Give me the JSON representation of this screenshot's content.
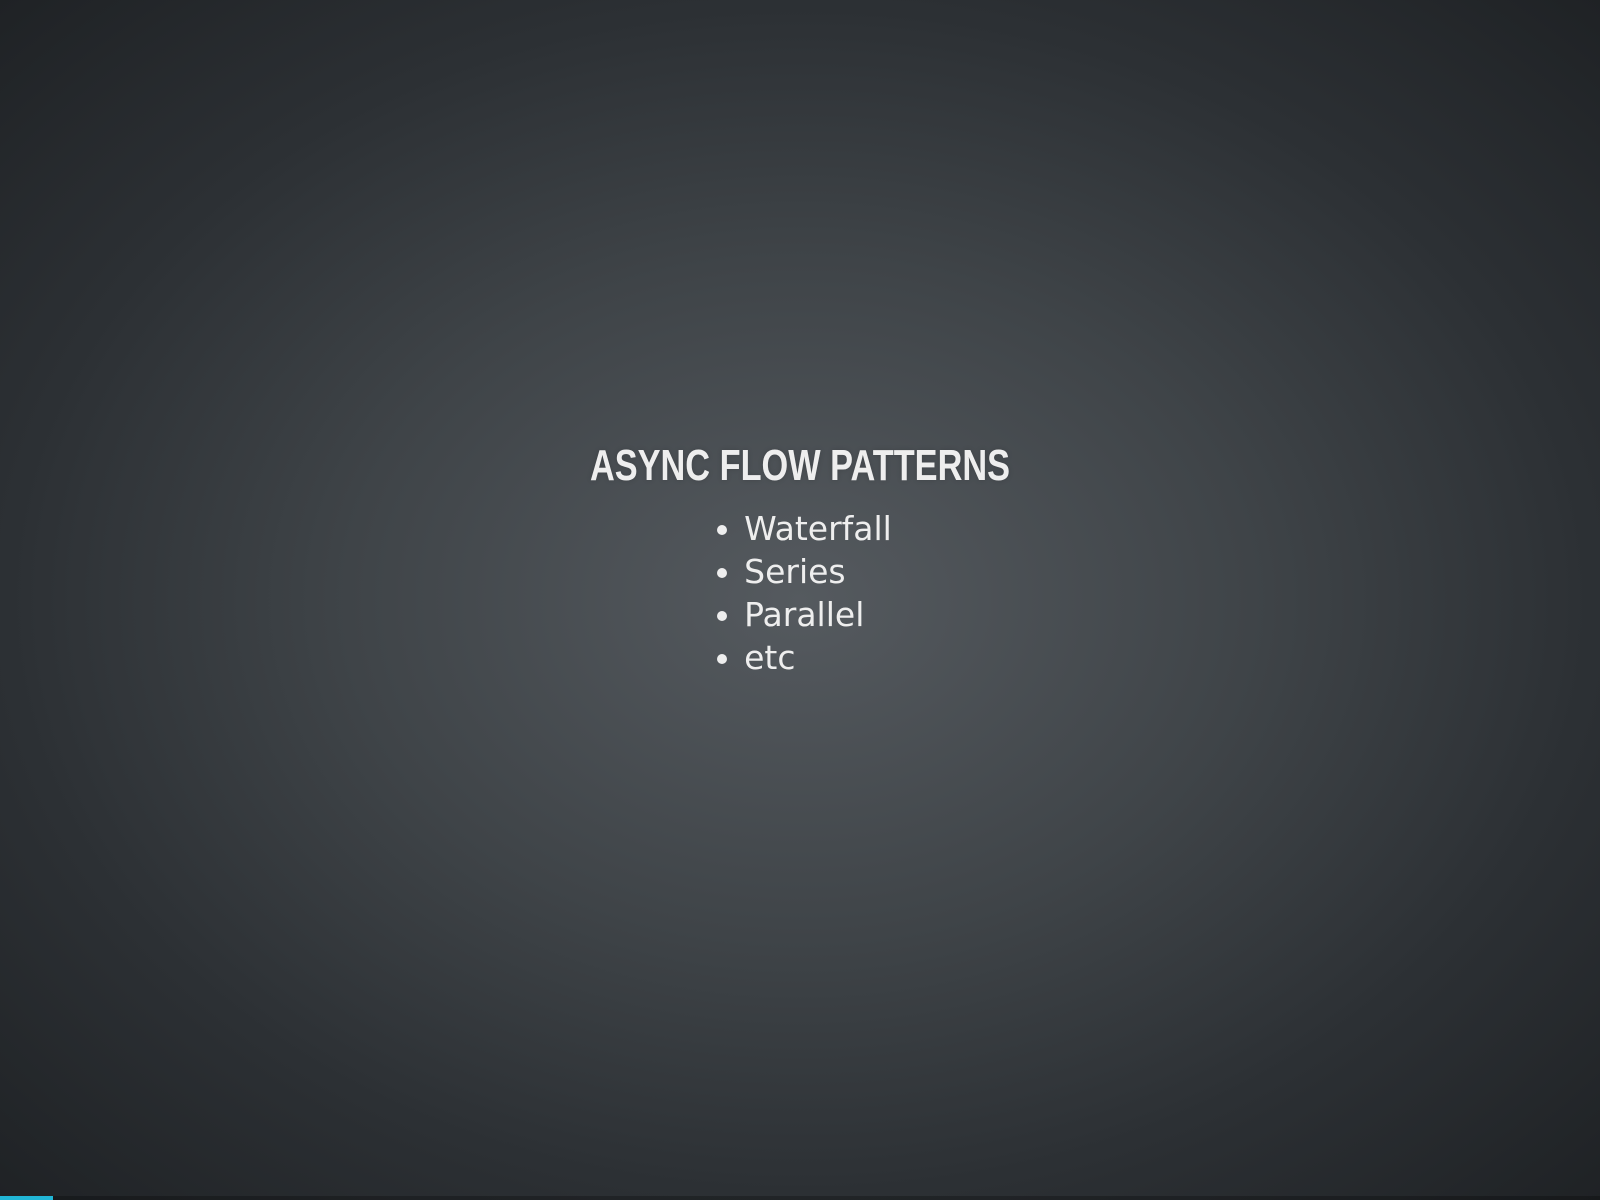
{
  "slide": {
    "title": "ASYNC FLOW PATTERNS",
    "items": [
      {
        "label": "Waterfall"
      },
      {
        "label": "Series"
      },
      {
        "label": "Parallel"
      },
      {
        "label": "etc"
      }
    ]
  },
  "progress": {
    "fraction": 0.033,
    "color": "#21b6d6"
  }
}
